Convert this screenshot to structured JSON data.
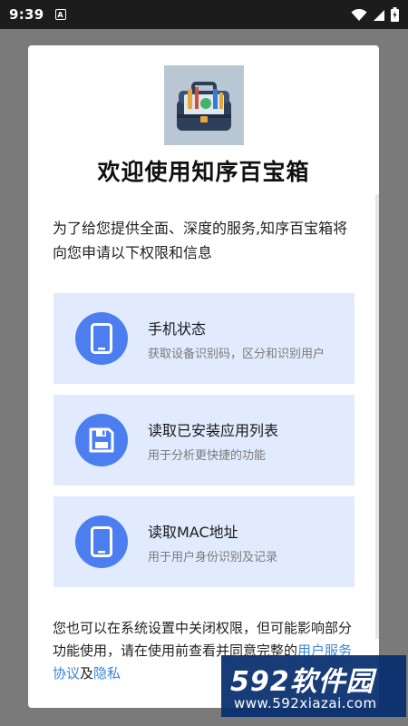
{
  "status_bar": {
    "time": "9:39",
    "notification_glyph": "A"
  },
  "dialog": {
    "title": "欢迎使用知序百宝箱",
    "intro": "为了给您提供全面、深度的服务,知序百宝箱将向您申请以下权限和信息",
    "permissions": [
      {
        "title": "手机状态",
        "desc": "获取设备识别码，区分和识别用户",
        "icon": "phone-icon"
      },
      {
        "title": "读取已安装应用列表",
        "desc": "用于分析更快捷的功能",
        "icon": "floppy-disk-icon"
      },
      {
        "title": "读取MAC地址",
        "desc": "用于用户身份识别及记录",
        "icon": "phone-icon"
      }
    ],
    "footer": {
      "text_before": "您也可以在系统设置中关闭权限，但可能影响部分功能使用，请在使用前查看并同意完整的",
      "link_service": "用户服务协议",
      "joiner": "及",
      "link_privacy": "隐私"
    }
  },
  "watermark": {
    "brand": "592软件园",
    "url": "www.592xiazai.com"
  },
  "colors": {
    "accent": "#4d7ef0",
    "card_bg": "#e1ebfd",
    "link": "#3a86d8"
  }
}
